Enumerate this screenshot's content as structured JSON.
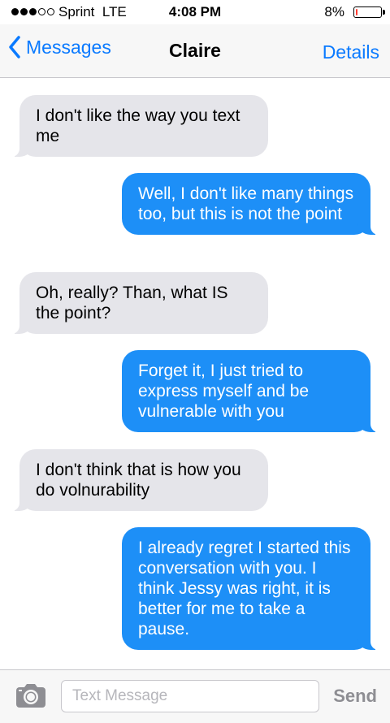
{
  "status_bar": {
    "carrier": "Sprint  LTE",
    "time": "4:08 PM",
    "battery_percent": "8%",
    "battery_level": 0.08,
    "signal_strength": 3,
    "signal_max": 5,
    "battery_color": "#ff3b30"
  },
  "nav": {
    "back_label": "Messages",
    "title": "Claire",
    "details_label": "Details",
    "accent_color": "#0a7aff"
  },
  "messages": [
    {
      "direction": "incoming",
      "text": "I don't like the way you text me"
    },
    {
      "direction": "outgoing",
      "text": "Well, I don't like many things too, but this is not the point"
    },
    {
      "direction": "incoming",
      "text": "Oh, really? Than, what IS the point?"
    },
    {
      "direction": "outgoing",
      "text": "Forget it, I just tried to express myself and be vulnerable with you"
    },
    {
      "direction": "incoming",
      "text": "I don't think that is how you do volnurability"
    },
    {
      "direction": "outgoing",
      "text": "I already regret I started this conversation with you. I think Jessy was right, it is better for me to take a pause."
    }
  ],
  "input_bar": {
    "placeholder": "Text Message",
    "value": "",
    "send_label": "Send",
    "camera_icon": "camera-icon"
  },
  "colors": {
    "incoming_bubble": "#e5e5ea",
    "outgoing_bubble": "#1d8ff7"
  }
}
